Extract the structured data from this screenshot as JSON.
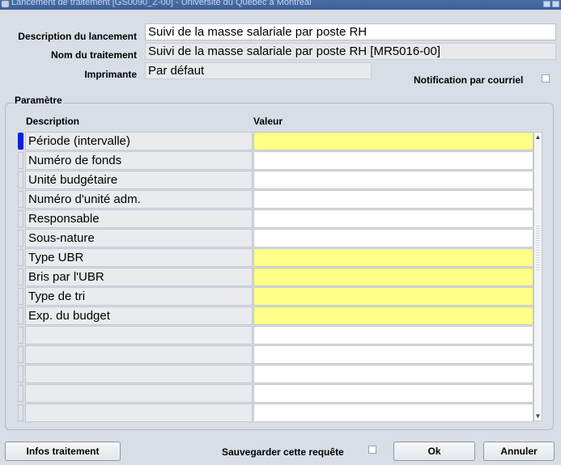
{
  "window": {
    "title": "Lancement de traitement [GS0090_Z-00] - Université du Québec à Montréal"
  },
  "header": {
    "description_label": "Description du lancement",
    "description_value": "Suivi de la masse salariale par poste RH",
    "process_label": "Nom du traitement",
    "process_value": "Suivi de la masse salariale par poste RH [MR5016-00]",
    "printer_label": "Imprimante",
    "printer_value": "Par défaut",
    "notification_label": "Notification par courriel",
    "notification_checked": false
  },
  "params": {
    "group_title": "Paramètre",
    "col_description": "Description",
    "col_value": "Valeur",
    "rows": [
      {
        "description": "Période (intervalle)",
        "value": "",
        "required": true,
        "current": true
      },
      {
        "description": "Numéro de fonds",
        "value": "",
        "required": false
      },
      {
        "description": "Unité budgétaire",
        "value": "",
        "required": false
      },
      {
        "description": "Numéro d'unité adm.",
        "value": "",
        "required": false
      },
      {
        "description": "Responsable",
        "value": "",
        "required": false
      },
      {
        "description": "Sous-nature",
        "value": "",
        "required": false
      },
      {
        "description": "Type UBR",
        "value": "",
        "required": true
      },
      {
        "description": "Bris par l'UBR",
        "value": "",
        "required": true
      },
      {
        "description": "Type de tri",
        "value": "",
        "required": true
      },
      {
        "description": "Exp. du budget",
        "value": "",
        "required": true
      },
      {
        "description": "",
        "value": "",
        "required": false
      },
      {
        "description": "",
        "value": "",
        "required": false
      },
      {
        "description": "",
        "value": "",
        "required": false
      },
      {
        "description": "",
        "value": "",
        "required": false
      },
      {
        "description": "",
        "value": "",
        "required": false
      }
    ]
  },
  "footer": {
    "info_button": "Infos traitement",
    "save_label": "Sauvegarder cette requête",
    "save_checked": false,
    "ok_button": "Ok",
    "cancel_button": "Annuler"
  },
  "colors": {
    "required_field": "#ffff88",
    "current_record": "#0a1fd6",
    "titlebar": "#3a5f98"
  }
}
